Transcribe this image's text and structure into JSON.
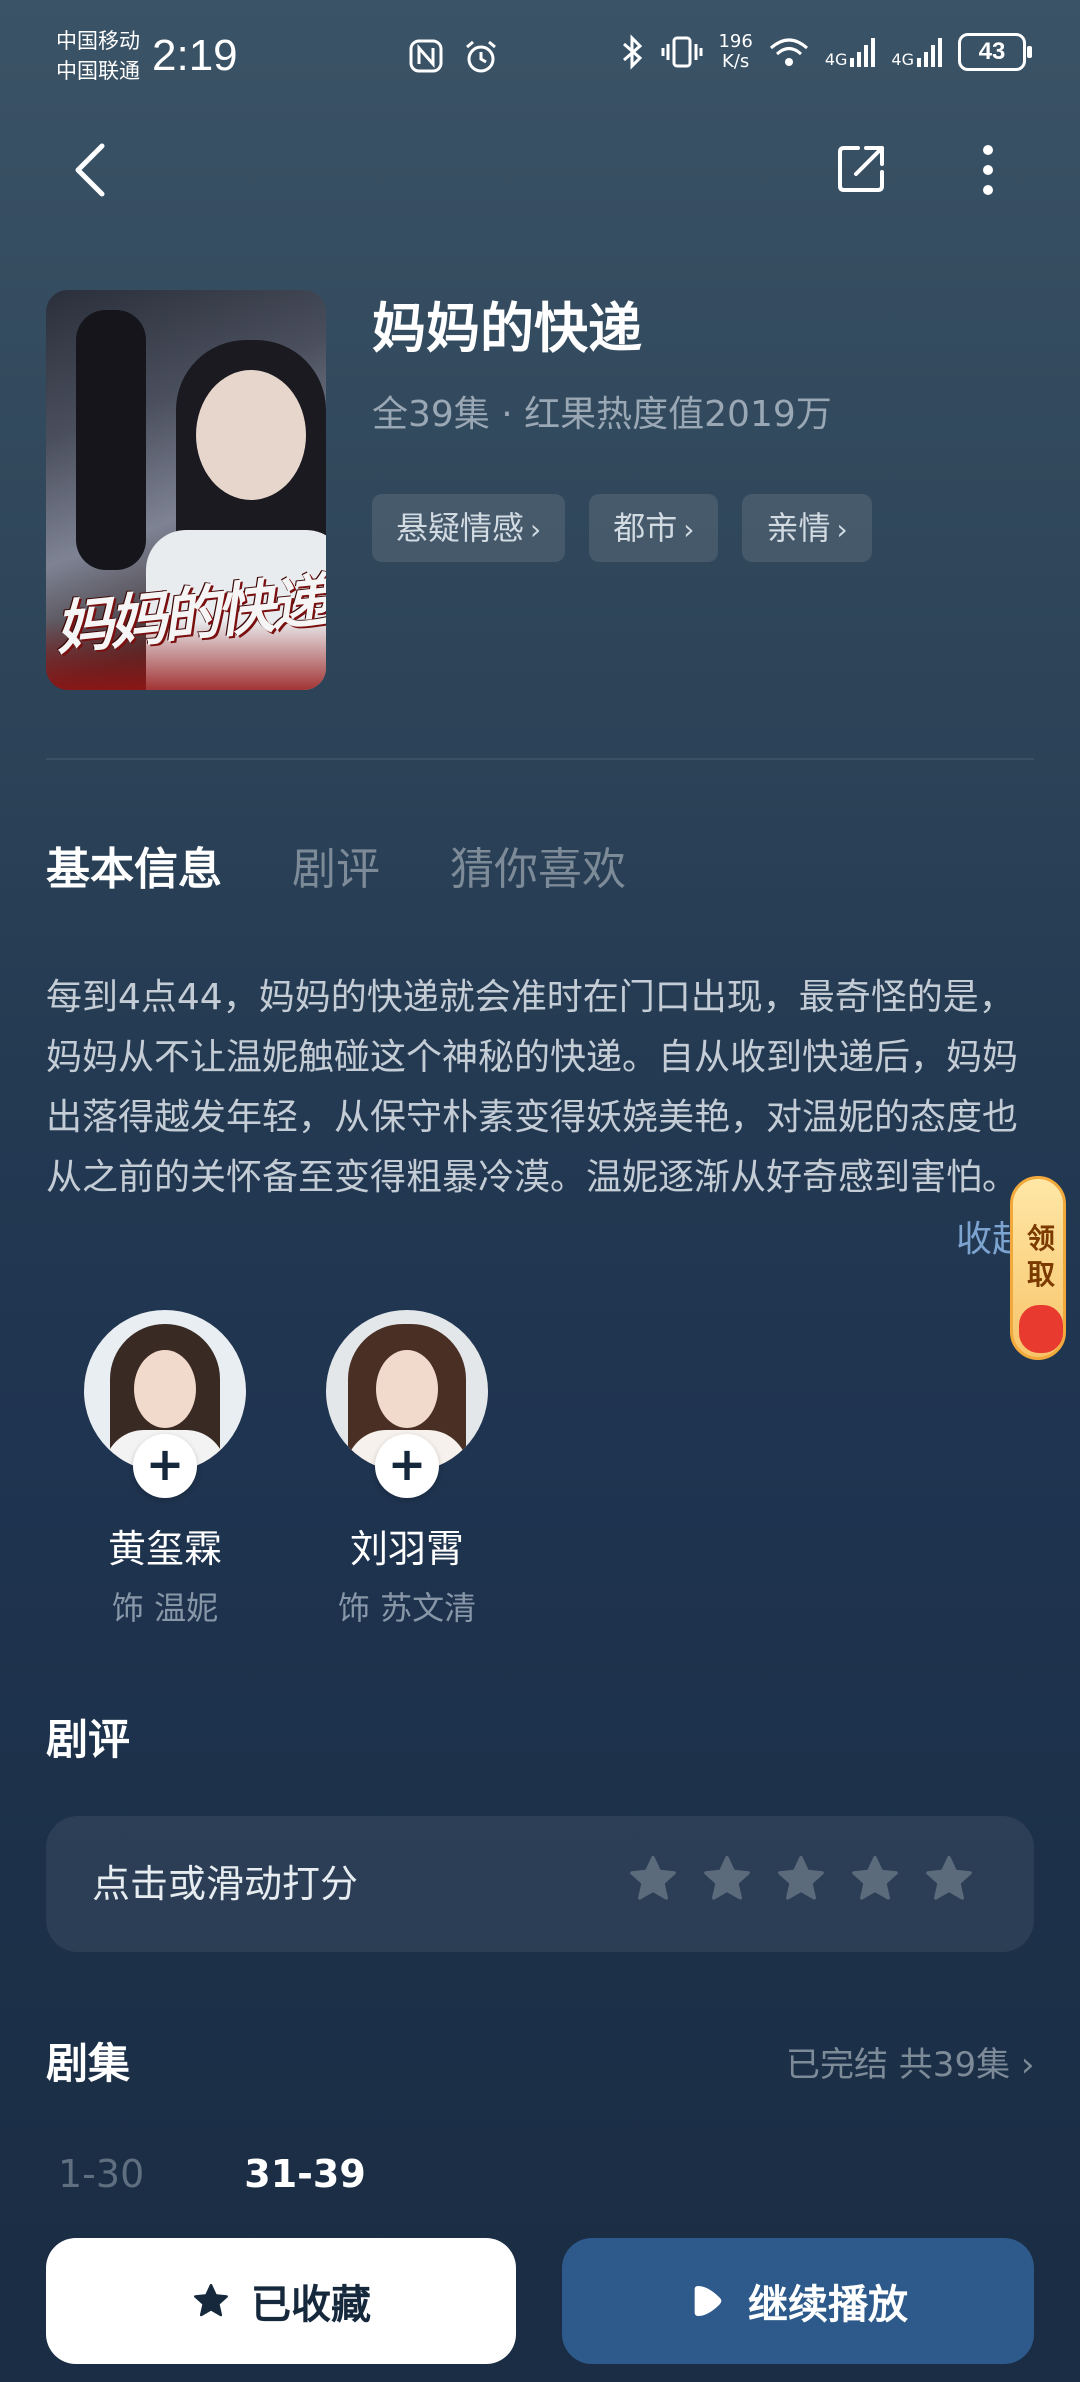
{
  "status_bar": {
    "carrier_1": "中国移动",
    "carrier_2": "中国联通",
    "time": "2:19",
    "net_speed_value": "196",
    "net_speed_unit": "K/s",
    "network_1": "4G",
    "network_2": "4G",
    "battery": "43"
  },
  "drama": {
    "title": "妈妈的快递",
    "poster_title": "妈妈的快递",
    "meta": "全39集 · 红果热度值2019万",
    "tags": [
      "悬疑情感",
      "都市",
      "亲情"
    ]
  },
  "tabs": [
    "基本信息",
    "剧评",
    "猜你喜欢"
  ],
  "description": "每到4点44，妈妈的快递就会准时在门口出现，最奇怪的是，妈妈从不让温妮触碰这个神秘的快递。自从收到快递后，妈妈出落得越发年轻，从保守朴素变得妖娆美艳，对温妮的态度也从之前的关怀备至变得粗暴冷漠。温妮逐渐从好奇感到害怕。",
  "collapse_label": "收起",
  "reward_label": "领取",
  "cast": [
    {
      "name": "黄玺霖",
      "role": "饰 温妮"
    },
    {
      "name": "刘羽霄",
      "role": "饰 苏文清"
    }
  ],
  "review": {
    "title": "剧评",
    "prompt": "点击或滑动打分",
    "stars_total": 5,
    "stars_selected": 0
  },
  "episodes": {
    "title": "剧集",
    "status": "已完结 共39集",
    "ranges": [
      "1-30",
      "31-39"
    ],
    "active_range": "31-39"
  },
  "actions": {
    "favorite_label": "已收藏",
    "play_label": "继续播放"
  },
  "colors": {
    "accent": "#2d5a8a",
    "link": "#7da4d0",
    "background": "#1f3450"
  }
}
